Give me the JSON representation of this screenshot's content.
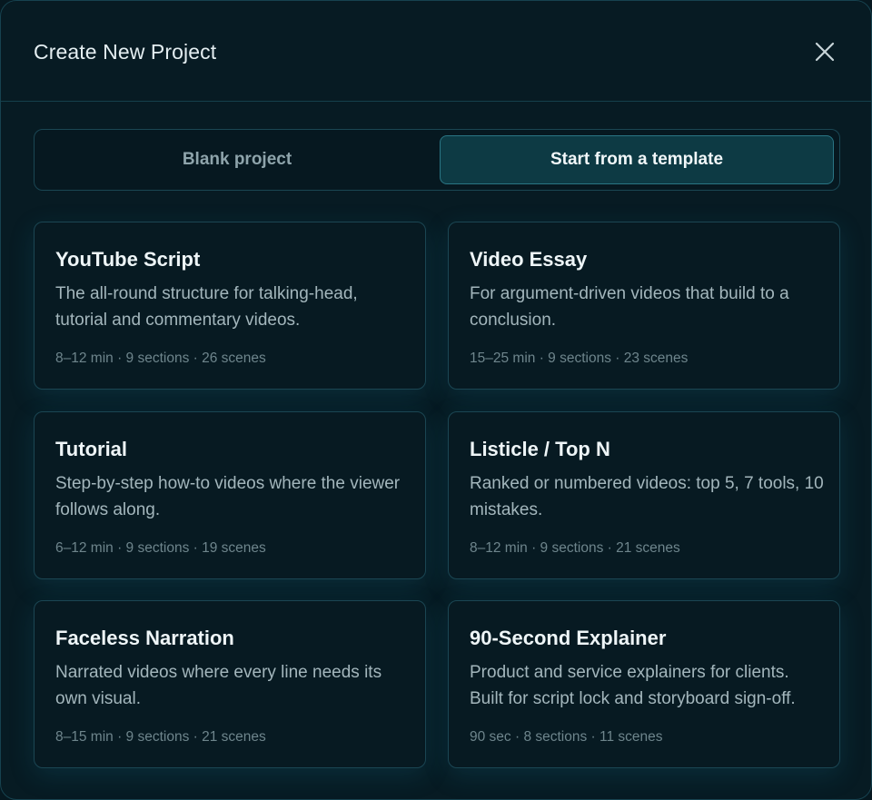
{
  "dialog": {
    "title": "Create New Project",
    "close_icon": "close-icon"
  },
  "mode_toggle": {
    "options": [
      {
        "label": "Blank project",
        "selected": false
      },
      {
        "label": "Start from a template",
        "selected": true
      }
    ]
  },
  "templates": [
    {
      "title": "YouTube Script",
      "description": "The all-round structure for talking-head, tutorial and commentary videos.",
      "meta": "8–12 min · 9 sections · 26 scenes"
    },
    {
      "title": "Video Essay",
      "description": "For argument-driven videos that build to a conclusion.",
      "meta": "15–25 min · 9 sections · 23 scenes"
    },
    {
      "title": "Tutorial",
      "description": "Step-by-step how-to videos where the viewer follows along.",
      "meta": "6–12 min · 9 sections · 19 scenes"
    },
    {
      "title": "Listicle / Top N",
      "description": "Ranked or numbered videos: top 5, 7 tools, 10 mistakes.",
      "meta": "8–12 min · 9 sections · 21 scenes"
    },
    {
      "title": "Faceless Narration",
      "description": "Narrated videos where every line needs its own visual.",
      "meta": "8–15 min · 9 sections · 21 scenes"
    },
    {
      "title": "90-Second Explainer",
      "description": "Product and service explainers for clients. Built for script lock and storyboard sign-off.",
      "meta": "90 sec · 8 sections · 11 scenes"
    }
  ],
  "colors": {
    "background": "#071b23",
    "accent": "#0d3a44",
    "accent_border": "#2a7584"
  }
}
